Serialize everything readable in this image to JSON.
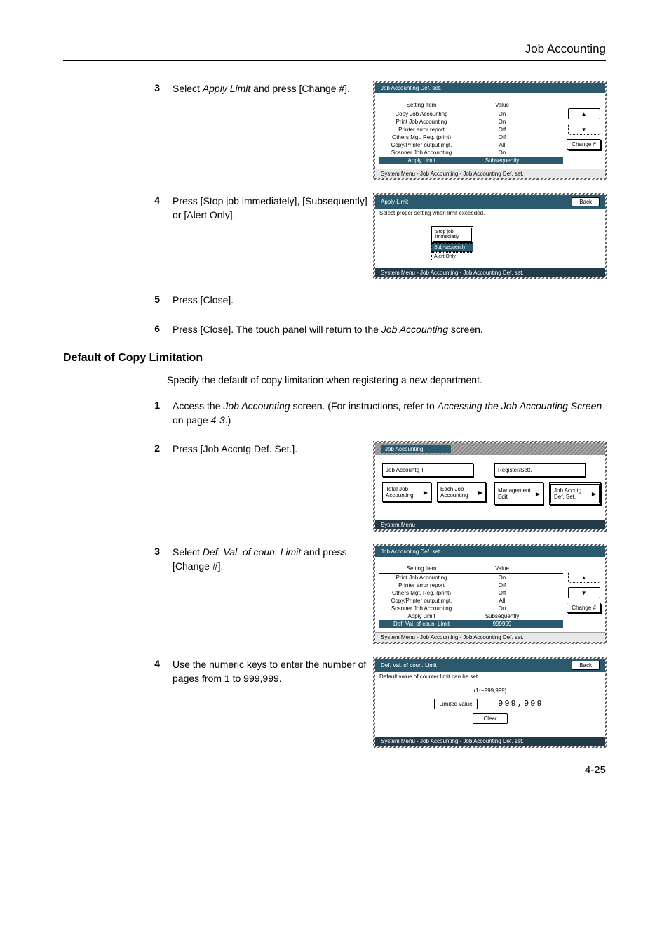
{
  "header": {
    "title": "Job Accounting"
  },
  "s3a": {
    "text_pre": "Select ",
    "text_em": "Apply Limit",
    "text_post": " and press [Change #]."
  },
  "s4a": {
    "text": "Press [Stop job immediately], [Subsequently] or [Alert Only]."
  },
  "s5a": {
    "text": "Press [Close]."
  },
  "s6a": {
    "text_pre": "Press [Close]. The touch panel will return to the ",
    "text_em": "Job Accounting",
    "text_post": " screen."
  },
  "section2": {
    "heading": "Default of Copy Limitation",
    "intro": "Specify the default of copy limitation when registering a new department."
  },
  "s1b": {
    "text_pre": "Access the ",
    "text_em1": "Job Accounting",
    "text_mid": " screen. (For instructions, refer to ",
    "text_em2": "Accessing the Job Accounting Screen",
    "text_post": " on page ",
    "text_em3": "4-3",
    "text_end": ".)"
  },
  "s2b": {
    "text": "Press [Job Accntg Def. Set.]."
  },
  "s3b": {
    "text_pre": "Select ",
    "text_em": "Def. Val. of coun. Limit",
    "text_post": " and press [Change #]."
  },
  "s4b": {
    "text": "Use the numeric keys to enter the number of pages from 1 to 999,999."
  },
  "panel1": {
    "title": "Job Accounting Def. set.",
    "col_item": "Setting Item",
    "col_value": "Value",
    "rows": [
      {
        "item": "Copy Job Accounting",
        "val": "On"
      },
      {
        "item": "Print Job Accounting",
        "val": "On"
      },
      {
        "item": "Printer error report",
        "val": "Off"
      },
      {
        "item": "Others Mgt. Reg. (print)",
        "val": "Off"
      },
      {
        "item": "Copy/Printer output mgt.",
        "val": "All"
      },
      {
        "item": "Scanner Job Accounting",
        "val": "On"
      },
      {
        "item": "Apply Limit",
        "val": "Subsequently"
      }
    ],
    "change": "Change #",
    "status": "System Menu      -  Job Accounting   -  Job Accounting Def. set."
  },
  "panel2": {
    "title": "Apply Limit",
    "back": "Back",
    "subtitle": "Select proper setting when limit exceeded.",
    "opts": [
      "Stop job immediatly",
      "Sub-sequently",
      "Alert Only"
    ],
    "status": "System Menu       -  Job Accounting   -   Job Accounting Def. set."
  },
  "panel3": {
    "title": "Job Accounting",
    "row1": [
      "Job Accountg T",
      "Register/Sett."
    ],
    "row2": [
      "Total Job Accounting",
      "Each Job Accounting",
      "Management Edit",
      "Job Accntg Def. Set."
    ],
    "status": "System Menu"
  },
  "panel4": {
    "title": "Job Accounting Def. set.",
    "col_item": "Setting Item",
    "col_value": "Value",
    "rows": [
      {
        "item": "Print Job Accounting",
        "val": "On"
      },
      {
        "item": "Printer error report",
        "val": "Off"
      },
      {
        "item": "Others Mgt. Reg. (print)",
        "val": "Off"
      },
      {
        "item": "Copy/Printer output mgt.",
        "val": "All"
      },
      {
        "item": "Scanner Job Accounting",
        "val": "On"
      },
      {
        "item": "Apply Limit",
        "val": "Subsequently"
      },
      {
        "item": "Def. Val. of coun. Limit",
        "val": "999999"
      }
    ],
    "change": "Change #",
    "status": "System Menu      -  Job Accounting   -  Job Accounting Def. set."
  },
  "panel5": {
    "title": "Def. Val. of coun. Limit",
    "back": "Back",
    "subtitle": "Default value of counter limit can be set.",
    "range": "(1～999,999)",
    "label": "Limited value",
    "value": "999,999",
    "clear": "Clear",
    "status": "System Menu       -  Job Accounting   -  Job Accounting Def. set."
  },
  "footer": {
    "pagenum": "4-25"
  }
}
